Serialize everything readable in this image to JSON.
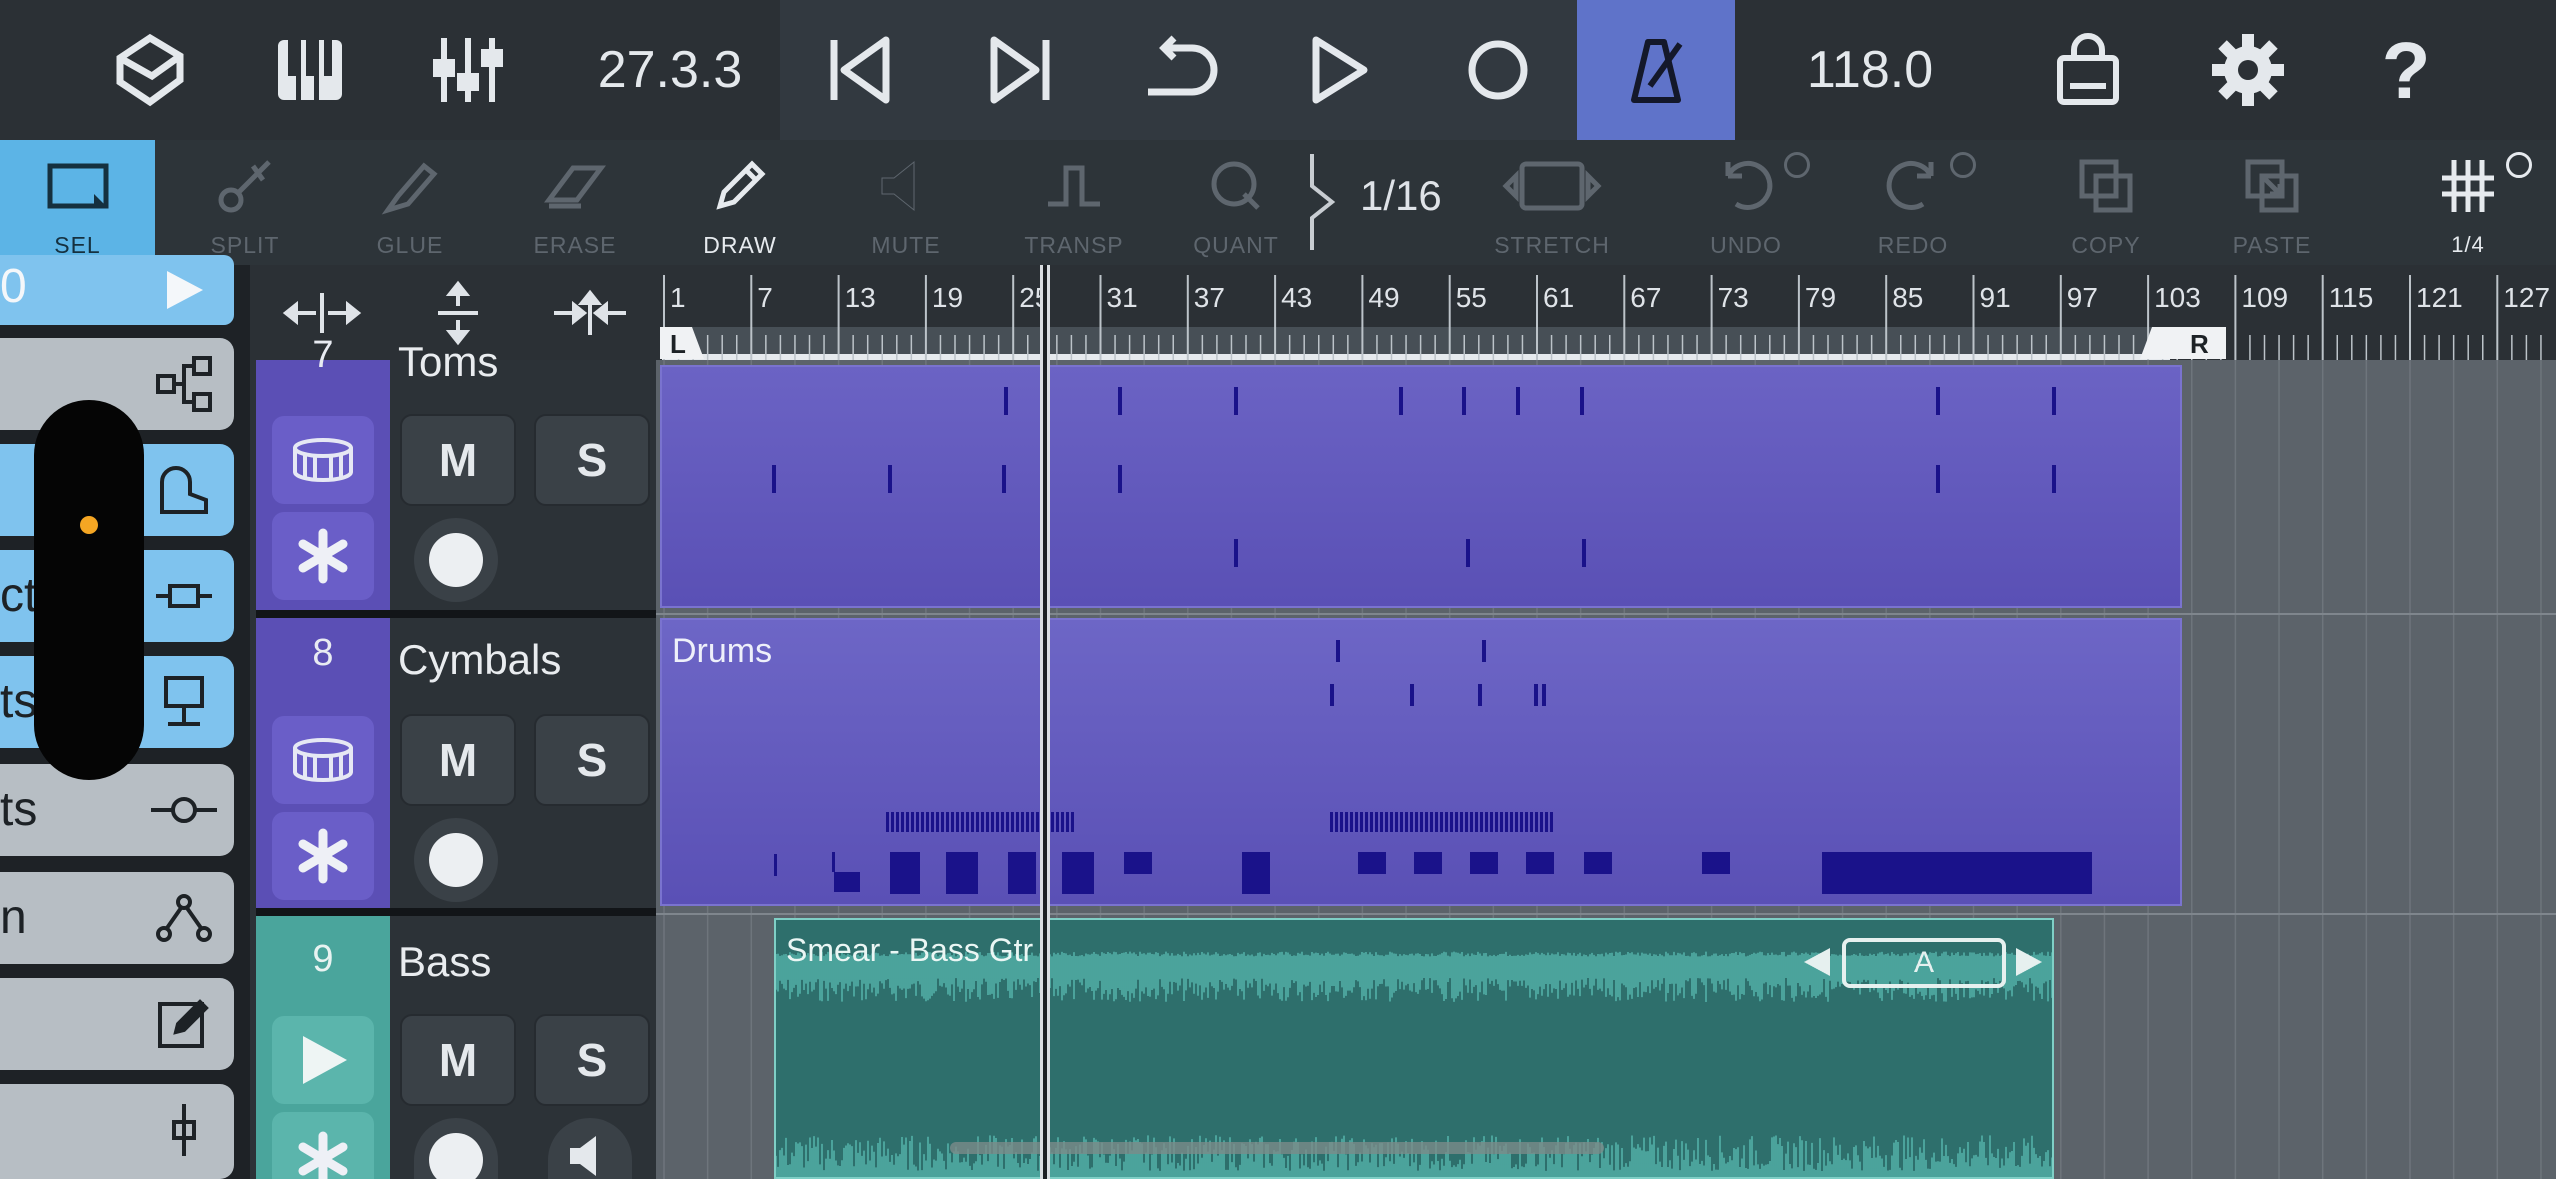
{
  "topbar": {
    "position": "27.3.3",
    "tempo": "118.0",
    "icons": [
      "cubase-logo-icon",
      "keyboard-icon",
      "mixer-icon",
      "skip-start-icon",
      "skip-end-icon",
      "cycle-icon",
      "play-icon",
      "record-icon",
      "metronome-icon",
      "shop-icon",
      "gear-icon",
      "help-icon"
    ],
    "metronome_active_color": "#5f73c9"
  },
  "toolbar": {
    "tools": [
      {
        "label": "SEL",
        "state": "active"
      },
      {
        "label": "SPLIT",
        "state": "disabled"
      },
      {
        "label": "GLUE",
        "state": "disabled"
      },
      {
        "label": "ERASE",
        "state": "disabled"
      },
      {
        "label": "DRAW",
        "state": "enabled"
      },
      {
        "label": "MUTE",
        "state": "disabled"
      },
      {
        "label": "TRANSP",
        "state": "disabled"
      },
      {
        "label": "QUANT",
        "state": "disabled"
      }
    ],
    "quantize_value": "1/16",
    "tools_right": [
      {
        "label": "STRETCH",
        "state": "disabled"
      },
      {
        "label": "UNDO",
        "state": "disabled"
      },
      {
        "label": "REDO",
        "state": "disabled"
      },
      {
        "label": "COPY",
        "state": "disabled"
      },
      {
        "label": "PASTE",
        "state": "disabled"
      }
    ],
    "grid_value": "1/4"
  },
  "left_panel": {
    "items": [
      {
        "text": "0",
        "icon": "play-icon"
      },
      {
        "text": "",
        "icon": "routing-icon"
      },
      {
        "text": "",
        "icon": "piano-icon"
      },
      {
        "text": "cts",
        "icon": "insert-icon"
      },
      {
        "text": "ts",
        "icon": "send-icon"
      },
      {
        "text": "ts",
        "icon": "eq-icon"
      },
      {
        "text": "n",
        "icon": "automation-icon"
      },
      {
        "text": "",
        "icon": "edit-icon"
      },
      {
        "text": "",
        "icon": "fader-icon"
      }
    ]
  },
  "ruler": {
    "bars": [
      "1",
      "7",
      "13",
      "19",
      "25",
      "31",
      "37",
      "43",
      "49",
      "55",
      "61",
      "67",
      "73",
      "79",
      "85",
      "91",
      "97",
      "103",
      "109",
      "115",
      "121",
      "127"
    ],
    "left_locator": "L",
    "right_locator": "R"
  },
  "tracks": [
    {
      "number": "7",
      "name": "Toms",
      "mute": "M",
      "solo": "S",
      "color": "#5b4fb5"
    },
    {
      "number": "8",
      "name": "Cymbals",
      "mute": "M",
      "solo": "S",
      "color": "#5b4fb5"
    },
    {
      "number": "9",
      "name": "Bass",
      "mute": "M",
      "solo": "S",
      "color": "#4aa59c"
    }
  ],
  "clips": {
    "drums_label": "Drums",
    "bass_label": "Smear - Bass Gtr",
    "audio_marker": "A"
  },
  "colors": {
    "midi_clip": "#6a62c2",
    "audio_clip": "#2e6f6c",
    "selection": "#5cb4e6"
  }
}
